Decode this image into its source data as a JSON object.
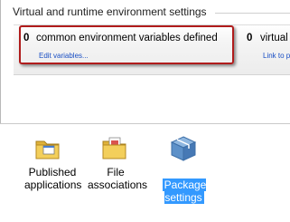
{
  "group": {
    "title": "Virtual and runtime environment settings"
  },
  "stats": [
    {
      "count": "0",
      "label": "common environment variables defined",
      "link": "Edit variables..."
    },
    {
      "count": "0",
      "label": "virtual",
      "link": "Link to p"
    }
  ],
  "items": [
    {
      "label": "Published\napplications",
      "icon": "folder-apps-icon",
      "selected": false
    },
    {
      "label": "File\nassociations",
      "icon": "folder-file-icon",
      "selected": false
    },
    {
      "label": "Package\nsettings",
      "icon": "package-box-icon",
      "selected": true
    }
  ],
  "colors": {
    "highlight": "#b01c1c",
    "link": "#1a4fc4",
    "selection": "#3399ff"
  }
}
